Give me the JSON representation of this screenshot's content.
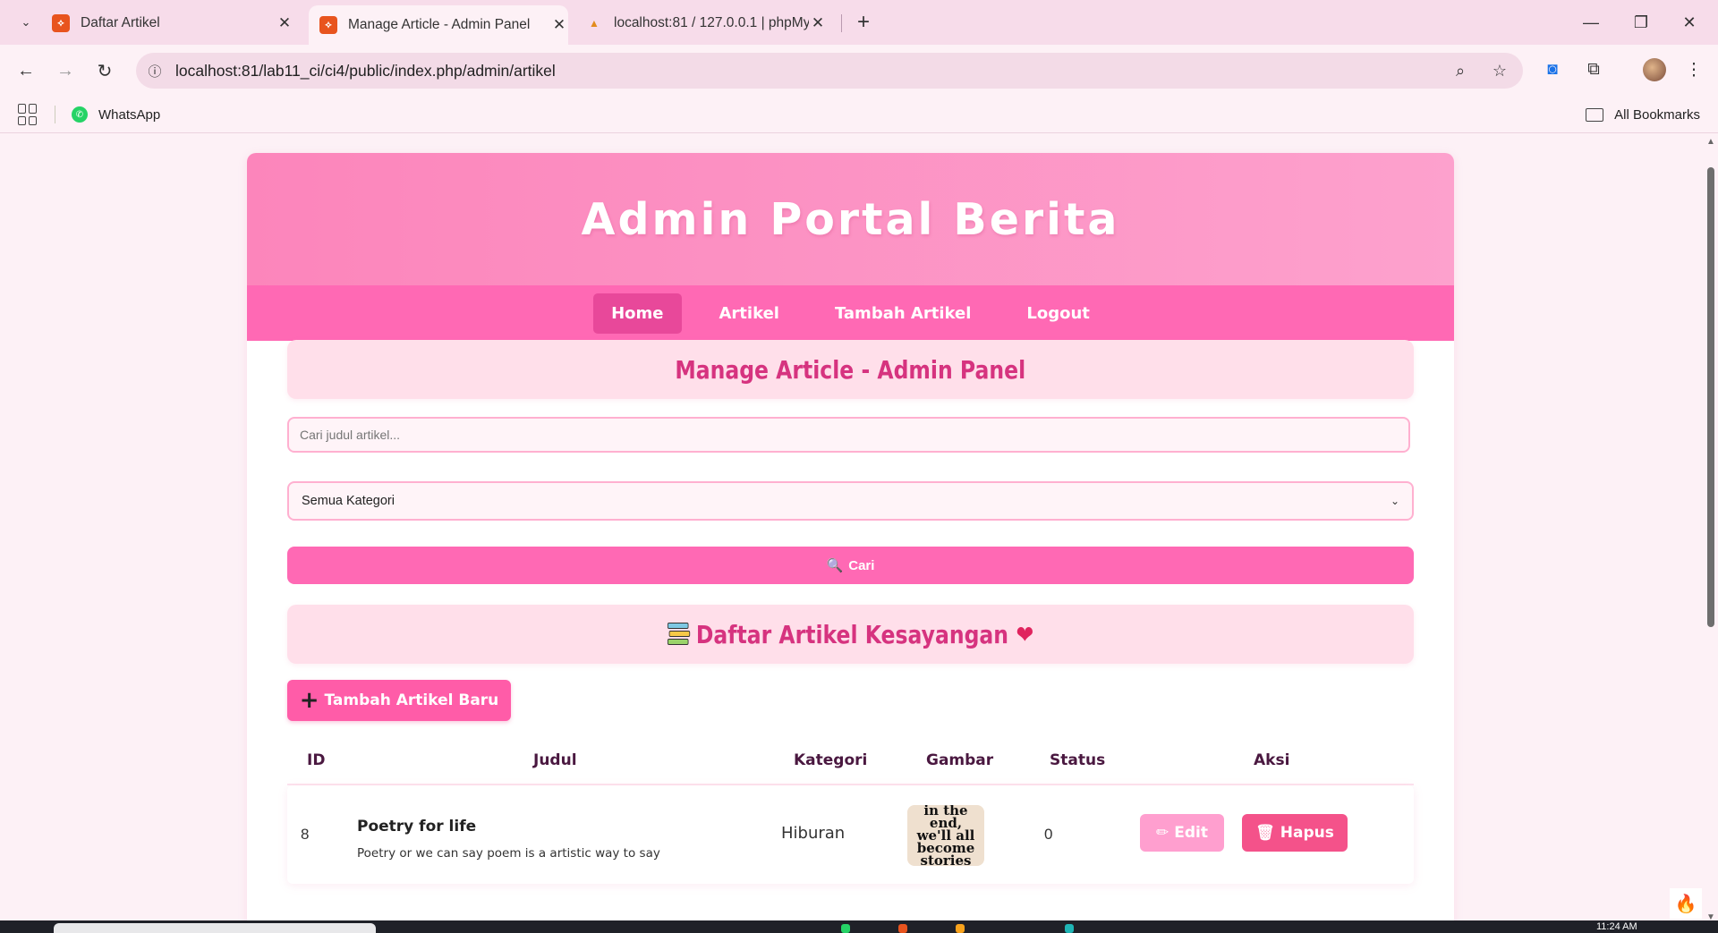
{
  "browser": {
    "tabs": [
      {
        "title": "Daftar Artikel",
        "favicon": "ci-icon"
      },
      {
        "title": "Manage Article - Admin Panel",
        "favicon": "ci-icon",
        "active": true
      },
      {
        "title": "localhost:81 / 127.0.0.1 | phpMy",
        "favicon": "phpmyadmin-icon"
      }
    ],
    "url": "localhost:81/lab11_ci/ci4/public/index.php/admin/artikel",
    "bookmarks": [
      {
        "label": "WhatsApp"
      }
    ],
    "all_bookmarks_label": "All Bookmarks"
  },
  "page": {
    "header_title": "Admin Portal Berita",
    "nav": [
      {
        "label": "Home",
        "active": true
      },
      {
        "label": "Artikel"
      },
      {
        "label": "Tambah Artikel"
      },
      {
        "label": "Logout"
      }
    ],
    "panel_title": "Manage Article - Admin Panel",
    "search": {
      "placeholder": "Cari judul artikel...",
      "value": ""
    },
    "category_select": {
      "selected": "Semua Kategori"
    },
    "search_button": "Cari",
    "list_title": "Daftar Artikel Kesayangan",
    "add_button": "Tambah Artikel Baru",
    "table": {
      "headers": [
        "ID",
        "Judul",
        "Kategori",
        "Gambar",
        "Status",
        "Aksi"
      ],
      "rows": [
        {
          "id": "8",
          "judul": "Poetry for life",
          "excerpt": "Poetry or we can say poem is a artistic way to say",
          "kategori": "Hiburan",
          "gambar_text": [
            "in the",
            "end,",
            "we'll all",
            "become",
            "stories"
          ],
          "status": "0",
          "edit_label": "Edit",
          "hapus_label": "Hapus"
        }
      ]
    }
  },
  "taskbar": {
    "clock": "11:24 AM"
  },
  "colors": {
    "accent": "#ff69b4",
    "header_gradient_start": "#fc85bb",
    "header_gradient_end": "#fda1cd",
    "title_pink": "#d6337f",
    "delete_red": "#f4528a"
  }
}
